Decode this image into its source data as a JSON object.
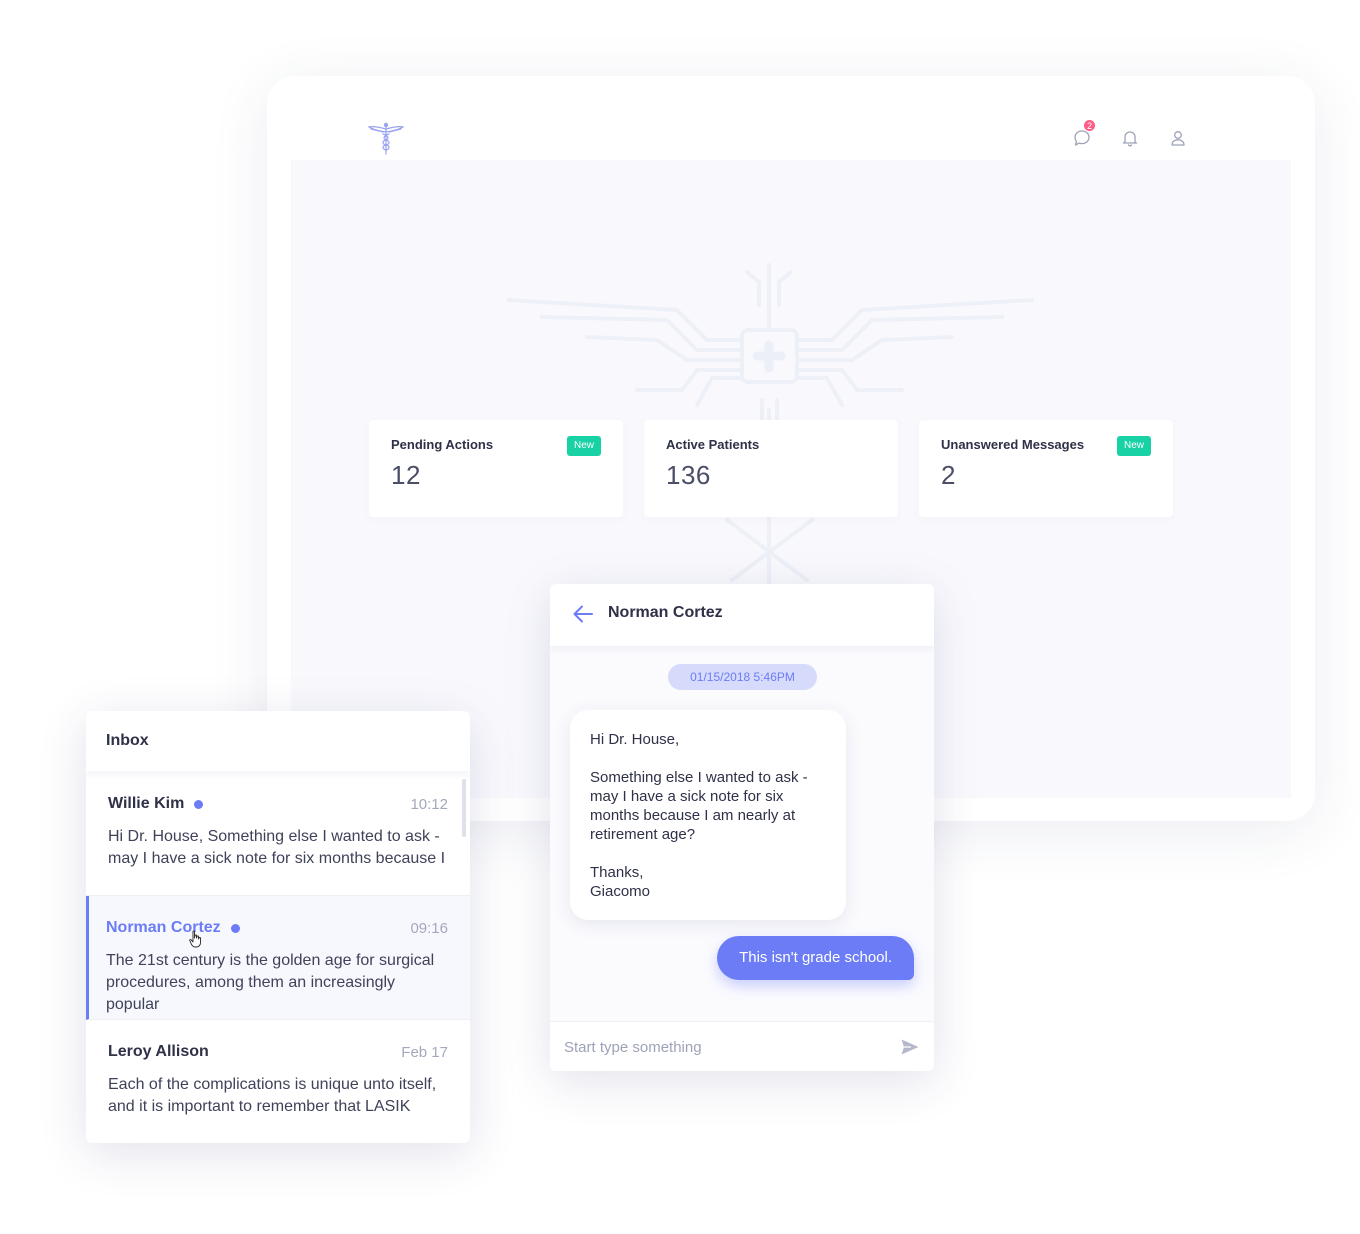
{
  "header": {
    "notification_count": "2",
    "icons": [
      "caduceus-logo-icon",
      "chat-icon",
      "bell-icon",
      "user-icon"
    ]
  },
  "stats": [
    {
      "title": "Pending Actions",
      "value": "12",
      "badge": "New"
    },
    {
      "title": "Active Patients",
      "value": "136",
      "badge": ""
    },
    {
      "title": "Unanswered Messages",
      "value": "2",
      "badge": "New"
    }
  ],
  "inbox": {
    "title": "Inbox",
    "messages": [
      {
        "name": "Willie Kim",
        "time": "10:12",
        "preview": "Hi Dr. House, Something else I wanted to ask - may I have a sick note for six months because I",
        "unread": true,
        "active": false
      },
      {
        "name": "Norman Cortez",
        "time": "09:16",
        "preview": "The 21st century is the golden age for surgical procedures, among them an increasingly popular",
        "unread": true,
        "active": true
      },
      {
        "name": "Leroy Allison",
        "time": "Feb 17",
        "preview": "Each of the complications is unique unto itself, and it is important to remember that LASIK",
        "unread": false,
        "active": false
      }
    ]
  },
  "chat": {
    "contact_name": "Norman Cortez",
    "date": "01/15/2018 5:46PM",
    "incoming_message": "Hi Dr. House,\n\nSomething else I wanted to ask - may I have a sick note for six months because I am nearly at retirement age?\n\nThanks,\nGiacomo",
    "outgoing_message": "This isn't grade school.",
    "input_placeholder": "Start type something"
  },
  "colors": {
    "accent": "#6b7cf6",
    "badge_green": "#18d1a5",
    "notification_pink": "#ff5b86",
    "date_pill_bg": "#d7dbfb"
  }
}
